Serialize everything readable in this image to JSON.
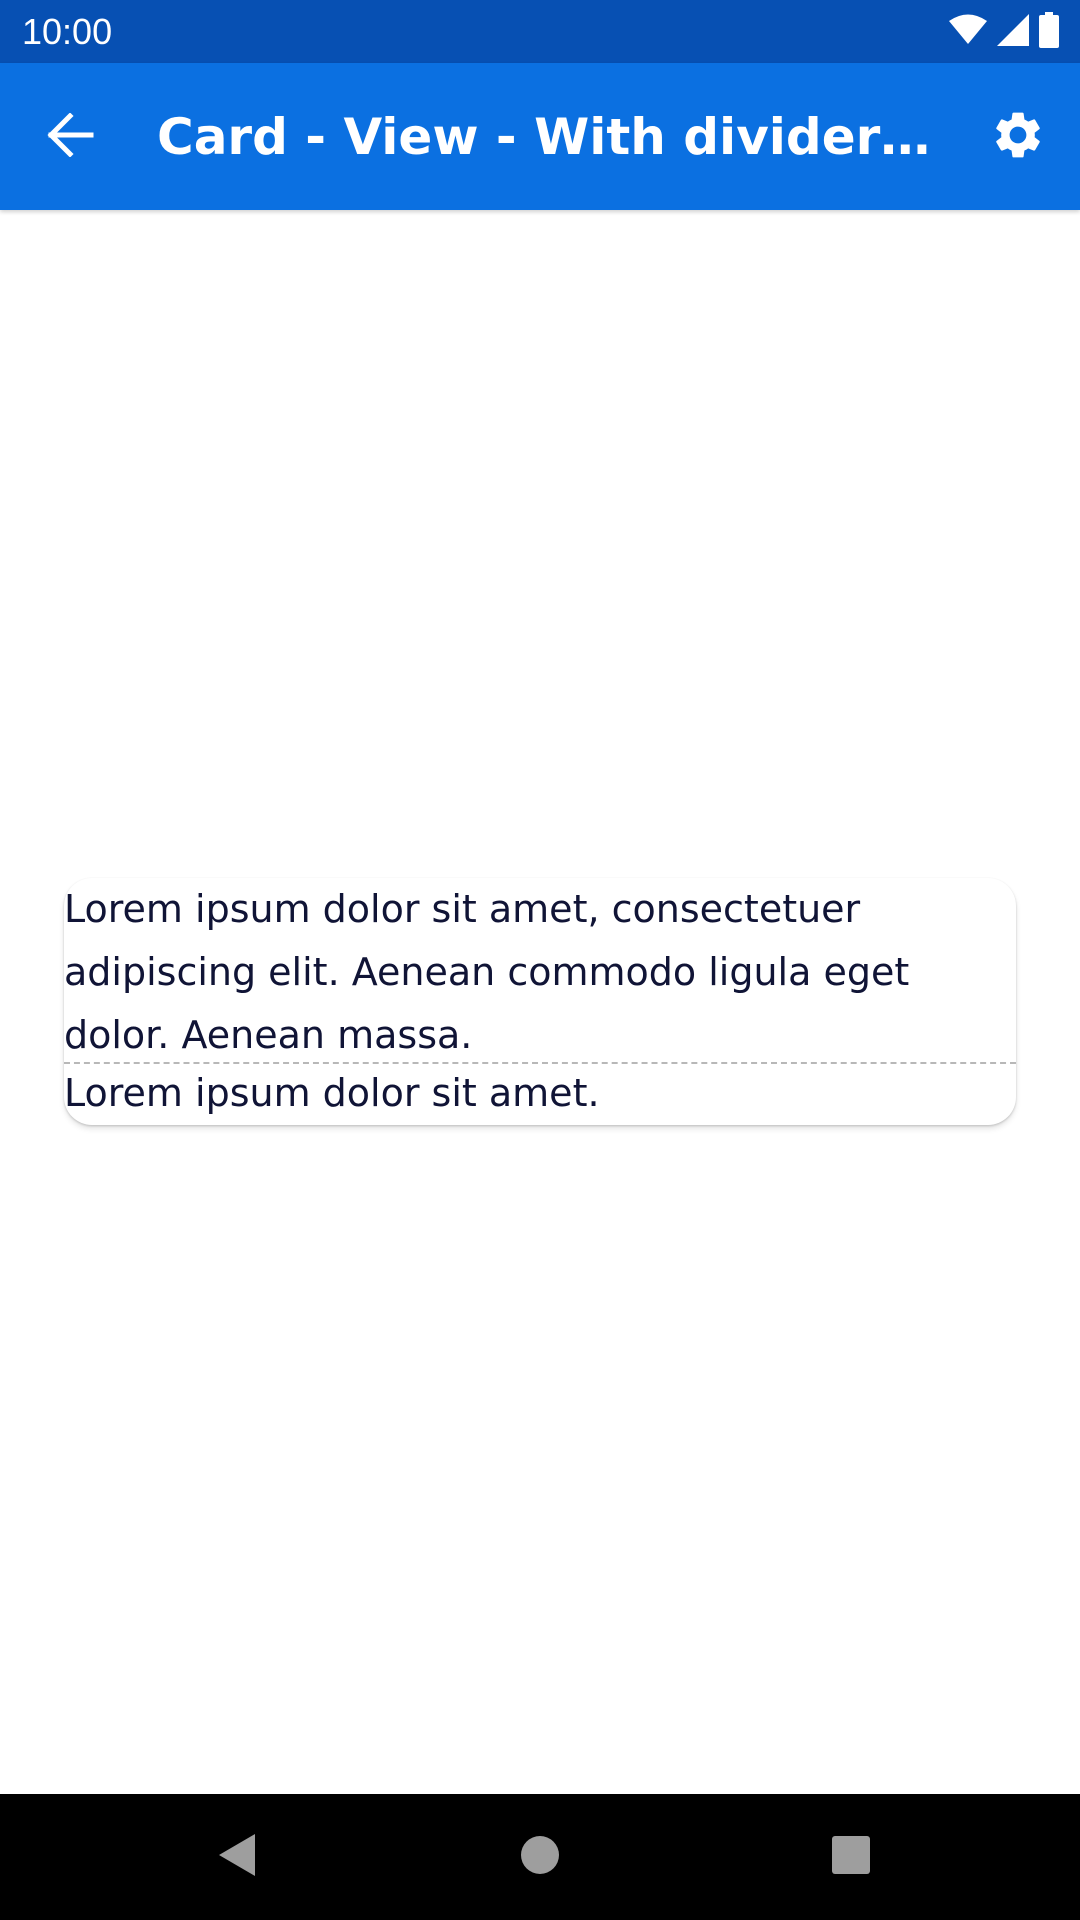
{
  "status_bar": {
    "time": "10:00",
    "icons": [
      "wifi-icon",
      "cellular-signal-icon",
      "battery-icon"
    ]
  },
  "app_bar": {
    "back_icon": "arrow-back-icon",
    "title": "Card - View - With divider with…",
    "settings_icon": "gear-icon",
    "background_color": "#0b70e1"
  },
  "card": {
    "body_text": "Lorem ipsum dolor sit amet, consectetuer adipiscing elit. Aenean commodo ligula eget dolor. Aenean massa.",
    "footer_text": "Lorem ipsum dolor sit amet.",
    "text_color": "#101436",
    "divider_style": "dashed"
  },
  "nav_bar": {
    "back_icon": "nav-back-triangle-icon",
    "home_icon": "nav-home-circle-icon",
    "recents_icon": "nav-recents-square-icon"
  }
}
